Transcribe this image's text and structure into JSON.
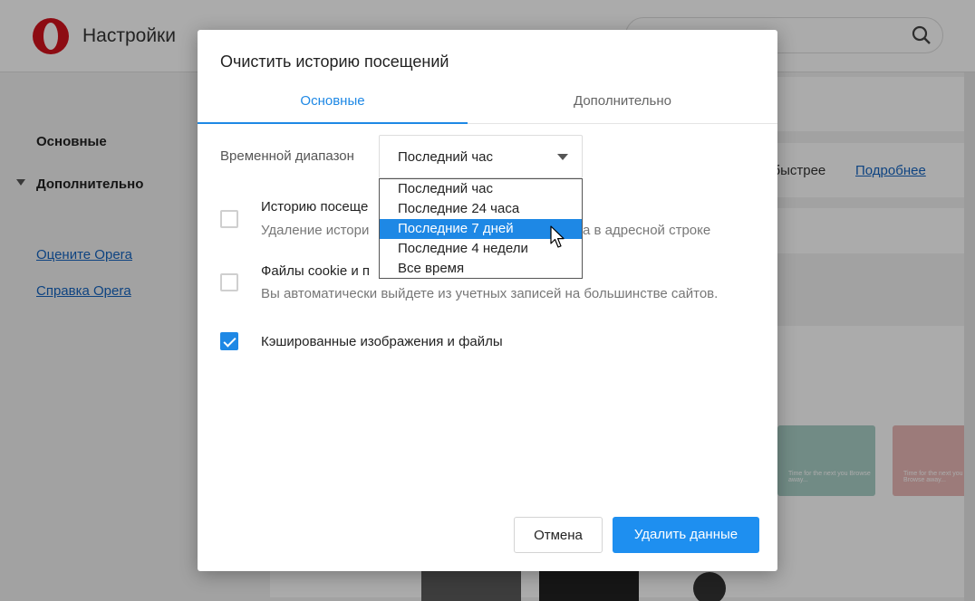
{
  "background": {
    "app_title": "Настройки",
    "nav": {
      "basic": "Основные",
      "advanced": "Дополнительно"
    },
    "links": {
      "rate": "Оцените Opera",
      "help": "Справка Opera"
    },
    "card_text": "а быстрее",
    "card_link": "Подробнее",
    "thumb_teal_text": "Time for the next you Browse away...",
    "thumb_pink_text": "Time for the next you Browse away..."
  },
  "dialog": {
    "title": "Очистить историю посещений",
    "tabs": [
      "Основные",
      "Дополнительно"
    ],
    "range_label": "Временной диапазон",
    "range_value": "Последний час",
    "options": [
      {
        "title": "Историю посеще",
        "desc": "Удаление истори",
        "desc_tail": "а в адресной строке",
        "checked": false
      },
      {
        "title": "Файлы cookie и п",
        "desc": "Вы автоматически выйдете из учетных записей на большинстве сайтов.",
        "checked": false
      },
      {
        "title": "Кэшированные изображения и файлы",
        "checked": true
      }
    ],
    "buttons": {
      "cancel": "Отмена",
      "delete": "Удалить данные"
    }
  },
  "dropdown": {
    "items": [
      "Последний час",
      "Последние 24 часа",
      "Последние 7 дней",
      "Последние 4 недели",
      "Все время"
    ],
    "highlighted_index": 2
  },
  "colors": {
    "accent": "#1e88e5",
    "brand": "#d2121d"
  }
}
